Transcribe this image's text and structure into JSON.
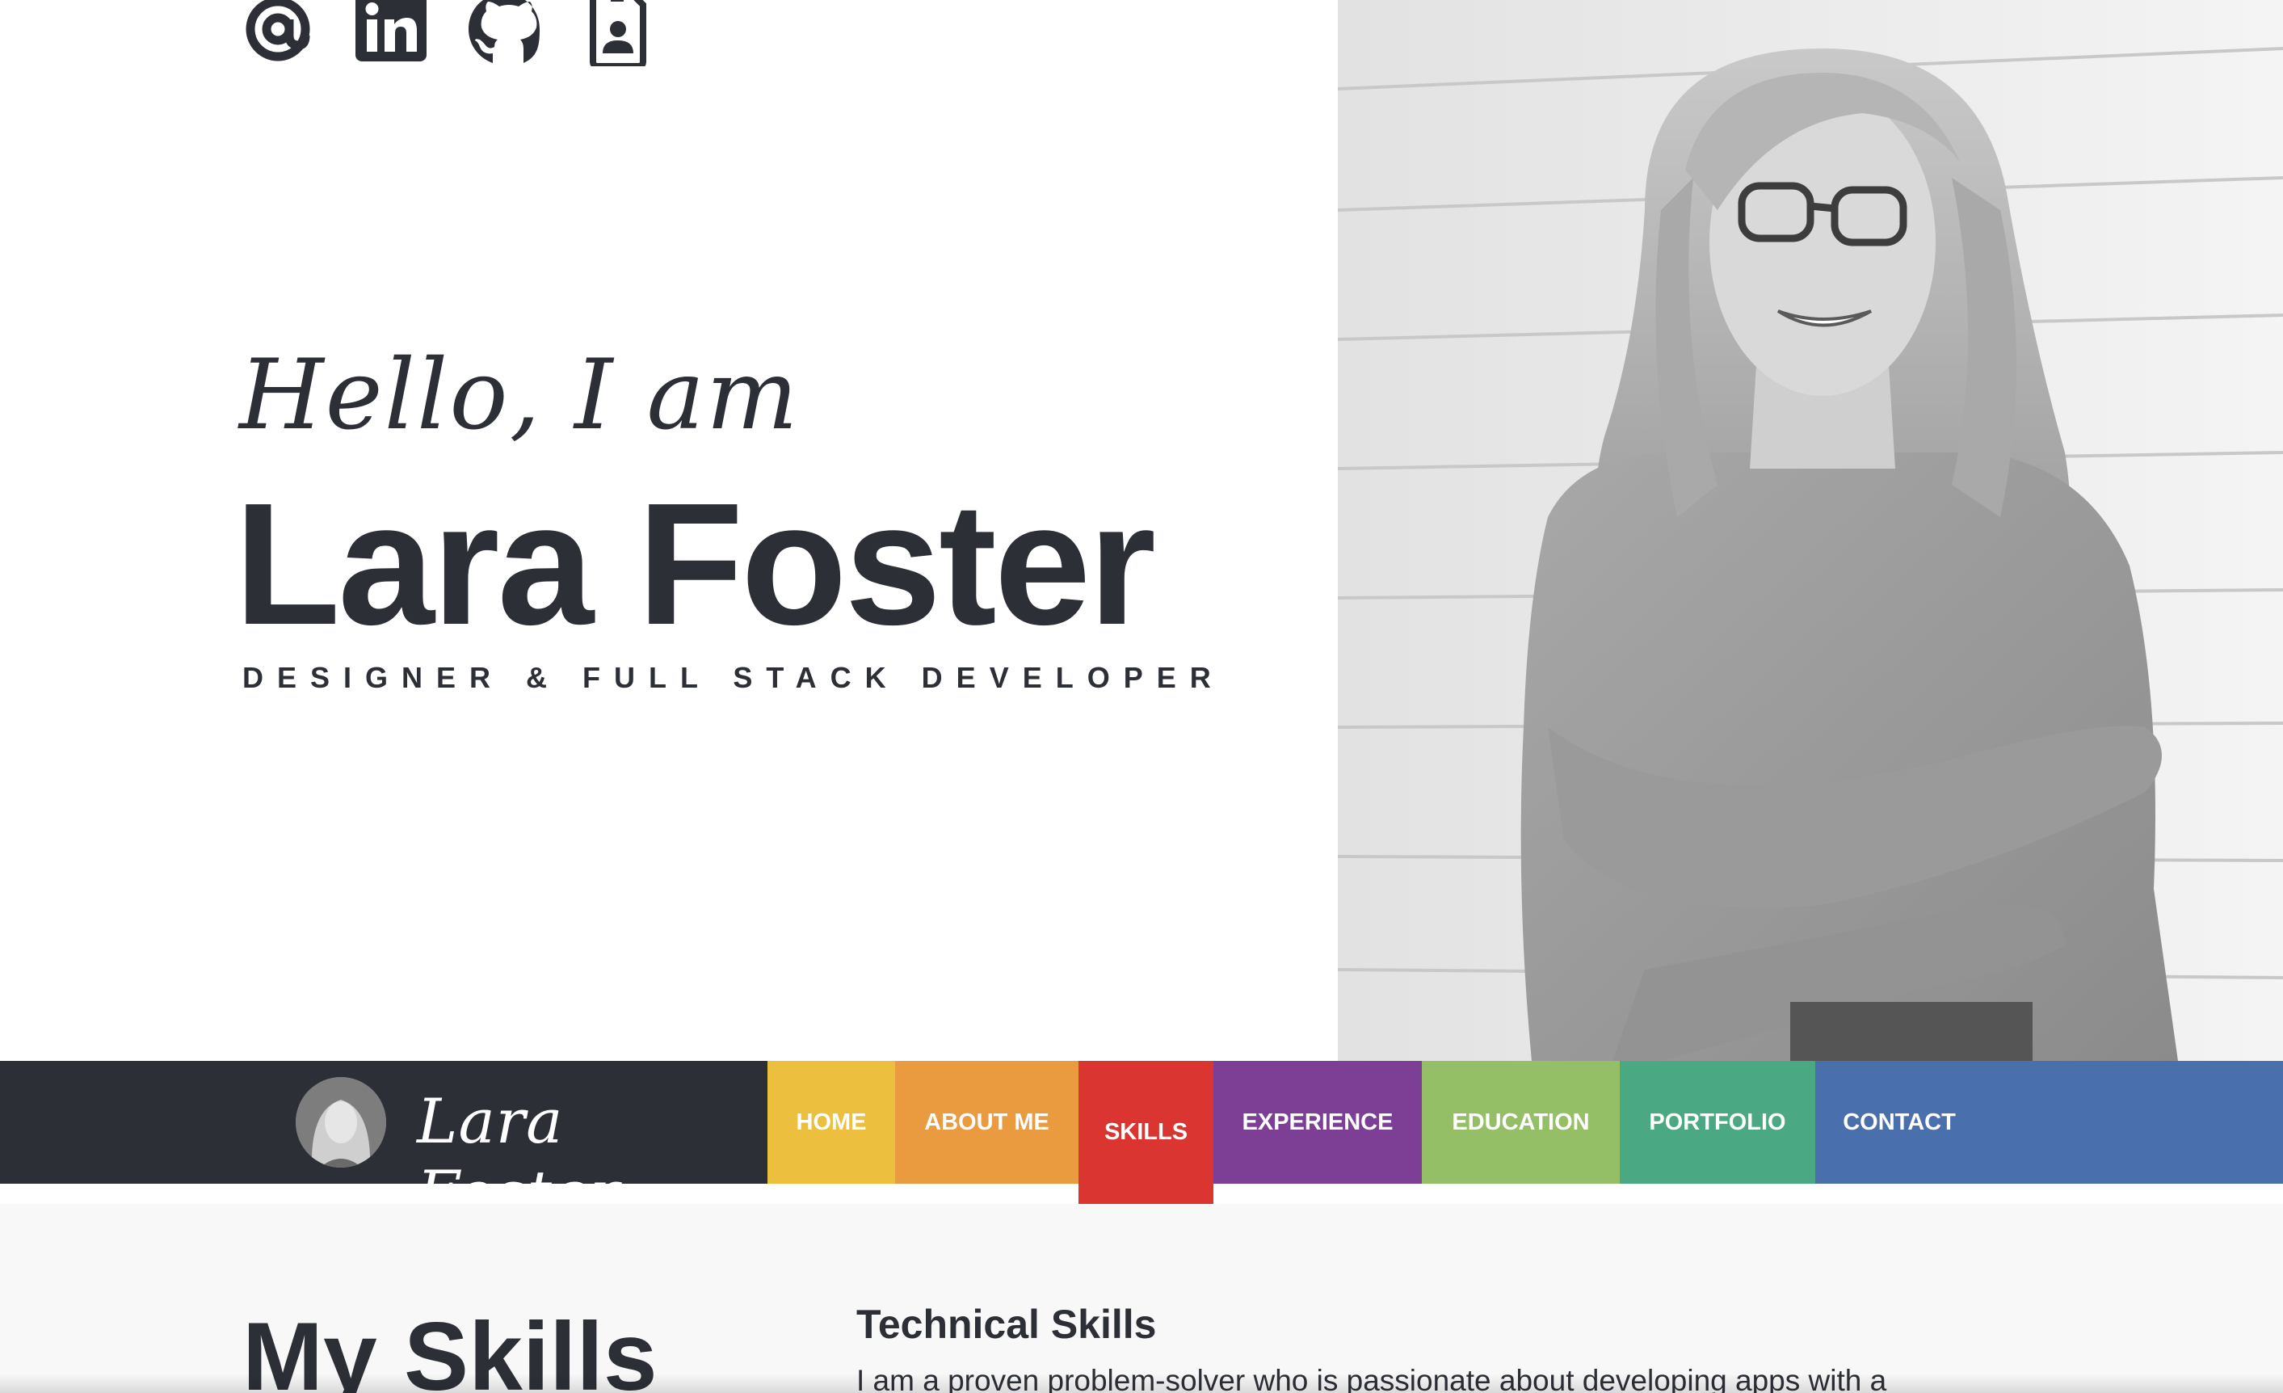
{
  "hero": {
    "socials": [
      {
        "icon": "at-icon",
        "label": "Email"
      },
      {
        "icon": "linkedin-icon",
        "label": "LinkedIn"
      },
      {
        "icon": "github-icon",
        "label": "GitHub"
      },
      {
        "icon": "contact-card-icon",
        "label": "Resume"
      }
    ],
    "greeting": "Hello, I am",
    "name": "Lara Foster",
    "role": "DESIGNER & FULL STACK DEVELOPER"
  },
  "navbar": {
    "brand_name": "Lara Foster",
    "items": [
      {
        "label": "HOME",
        "color": "#ecbf3f"
      },
      {
        "label": "ABOUT ME",
        "color": "#ea9a3f"
      },
      {
        "label": "SKILLS",
        "color": "#db3532",
        "active": true
      },
      {
        "label": "EXPERIENCE",
        "color": "#7c3f95"
      },
      {
        "label": "EDUCATION",
        "color": "#94bf66"
      },
      {
        "label": "PORTFOLIO",
        "color": "#4aa882"
      },
      {
        "label": "CONTACT",
        "color": "#4a6fad"
      }
    ],
    "bar_color": "#4a6fad",
    "brand_bg": "#2d2f37"
  },
  "skills": {
    "title": "My Skills",
    "subtitle": "Technical Skills",
    "text": "I am a proven problem-solver who is passionate about developing apps with a"
  }
}
